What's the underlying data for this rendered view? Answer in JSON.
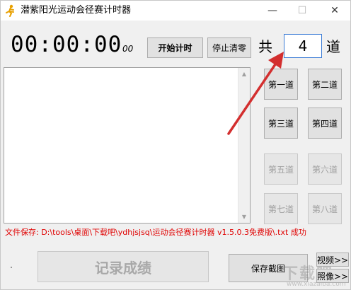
{
  "window": {
    "title": "潜紫阳光运动会径赛计时器",
    "minimize_glyph": "—",
    "maximize_glyph": "☐",
    "close_glyph": "✕"
  },
  "timer": {
    "display": "00:00:00",
    "milliseconds": "00"
  },
  "controls": {
    "start_label": "开始计时",
    "stop_clear_label": "停止清零"
  },
  "lanes": {
    "total_prefix": "共",
    "count": "4",
    "suffix": "道",
    "buttons": [
      {
        "label": "第一道",
        "enabled": true
      },
      {
        "label": "第二道",
        "enabled": true
      },
      {
        "label": "第三道",
        "enabled": true
      },
      {
        "label": "第四道",
        "enabled": true
      },
      {
        "label": "第五道",
        "enabled": false
      },
      {
        "label": "第六道",
        "enabled": false
      },
      {
        "label": "第七道",
        "enabled": false
      },
      {
        "label": "第八道",
        "enabled": false
      }
    ]
  },
  "log": {
    "content": ""
  },
  "status": {
    "save_path": "文件保存: D:\\tools\\桌面\\下载吧\\ydhjsjsq\\运动会径赛计时器 v1.5.0.3免费版\\.txt 成功"
  },
  "footer": {
    "record_label": "记录成绩",
    "save_screenshot_label": "保存截图",
    "video_label": "视频>>",
    "photo_label": "照像>>"
  },
  "watermark": {
    "text": "下载吧",
    "sub": "www.xiazaiba.com"
  },
  "colors": {
    "status_text": "#e00000",
    "annotation_arrow": "#d32f2f",
    "focus_border": "#3a7bd5"
  }
}
